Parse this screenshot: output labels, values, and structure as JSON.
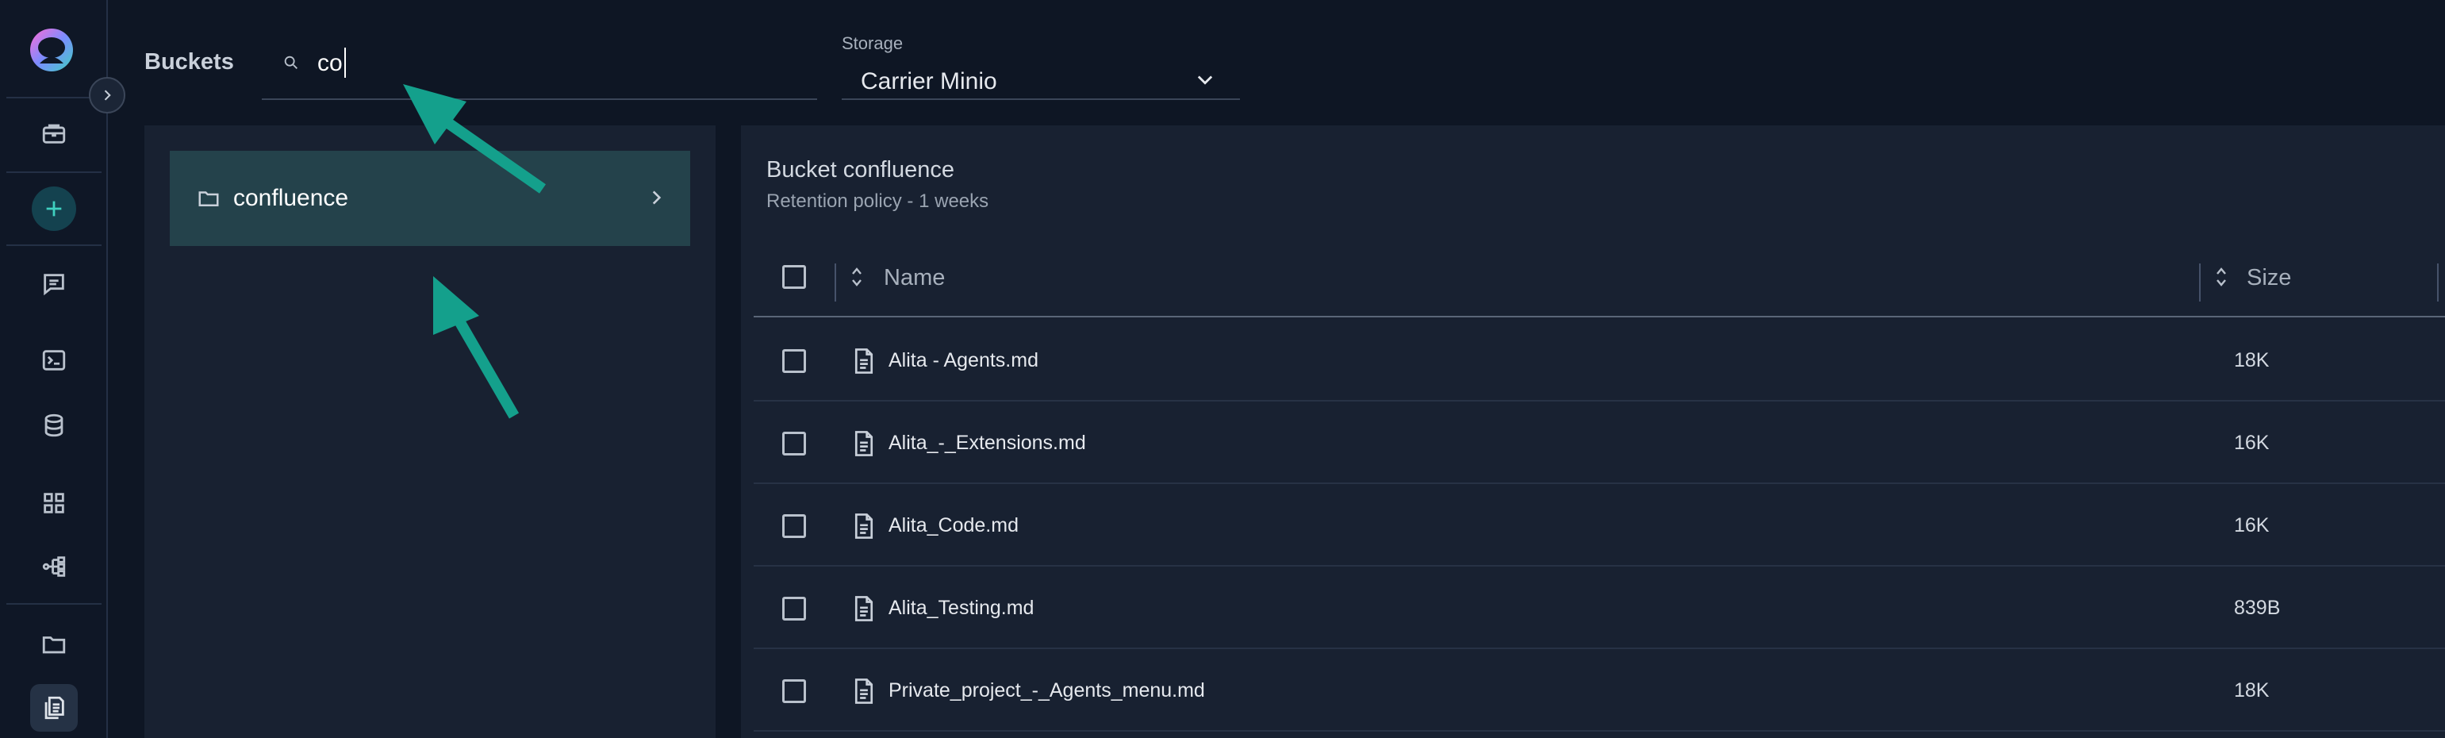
{
  "sidebar": {
    "items": [
      {
        "icon": "briefcase-icon"
      },
      {
        "icon": "plus-icon"
      },
      {
        "icon": "chat-icon"
      },
      {
        "icon": "terminal-icon"
      },
      {
        "icon": "database-icon"
      },
      {
        "icon": "apps-grid-icon"
      },
      {
        "icon": "flow-icon"
      },
      {
        "icon": "folder-icon"
      },
      {
        "icon": "documents-icon"
      }
    ],
    "active": "documents-icon",
    "accent": "#3fd0c0"
  },
  "header": {
    "title": "Buckets",
    "search": {
      "value": "co",
      "placeholder": ""
    },
    "storage_label": "Storage",
    "storage_value": "Carrier Minio"
  },
  "buckets": [
    {
      "name": "confluence"
    }
  ],
  "bucket_detail": {
    "title": "Bucket confluence",
    "retention": "Retention policy - 1 weeks",
    "columns": {
      "name": "Name",
      "size": "Size"
    },
    "files": [
      {
        "name": "Alita - Agents.md",
        "size": "18K"
      },
      {
        "name": "Alita_-_Extensions.md",
        "size": "16K"
      },
      {
        "name": "Alita_Code.md",
        "size": "16K"
      },
      {
        "name": "Alita_Testing.md",
        "size": "839B"
      },
      {
        "name": "Private_project_-_Agents_menu.md",
        "size": "18K"
      }
    ]
  },
  "colors": {
    "background": "#0e1624",
    "panel": "#182131",
    "selected_bucket": "#24424b",
    "annotation_arrow": "#14a08c"
  }
}
